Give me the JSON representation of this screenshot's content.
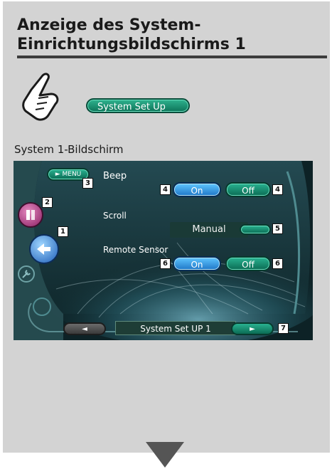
{
  "heading": {
    "line1": "Anzeige des System-",
    "line2": "Einrichtungsbildschirms 1"
  },
  "system_setup_button": {
    "label": "System Set Up"
  },
  "subheading": "System 1-Bildschirm",
  "screen": {
    "menu_button": {
      "label": "► MENU"
    },
    "beep": {
      "label": "Beep",
      "on": "On",
      "off": "Off"
    },
    "scroll": {
      "label": "Scroll",
      "value": "Manual"
    },
    "remote_sensor": {
      "label": "Remote Sensor",
      "on": "On",
      "off": "Off"
    },
    "prev_button": {
      "label": "◄"
    },
    "next_button": {
      "label": "►"
    },
    "status": "System Set UP 1"
  },
  "callouts": {
    "n1": "1",
    "n2": "2",
    "n3": "3",
    "n4": "4",
    "n5": "5",
    "n6": "6",
    "n7": "7"
  },
  "colors": {
    "on_button": "#2f8fe0",
    "off_button": "#18936f",
    "page_bg": "#d3d3d3"
  },
  "icons": [
    "pointing-hand-icon",
    "down-arrow-icon",
    "back-icon",
    "audio-icon",
    "wrench-icon"
  ]
}
